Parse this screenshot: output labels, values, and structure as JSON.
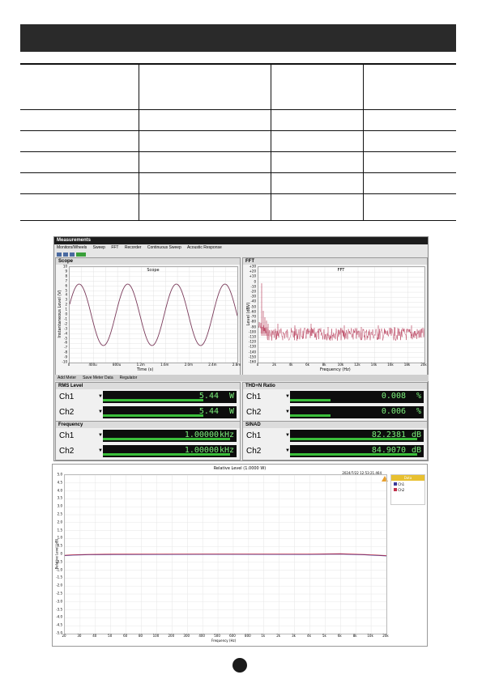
{
  "measurements": {
    "window_title": "Measurements",
    "menu": [
      "Monitors/Wheels",
      "Sweep",
      "FFT",
      "Recorder",
      "Continuous Sweep",
      "Acoustic Response"
    ],
    "scope": {
      "label": "Scope",
      "plot_title": "Scope",
      "xlabel": "Time (s)",
      "ylabel": "Instantaneous Level (V)",
      "yticks": [
        "10",
        "9",
        "8",
        "7",
        "6",
        "5",
        "4",
        "3",
        "2",
        "1",
        "0",
        "-1",
        "-2",
        "-3",
        "-4",
        "-5",
        "-6",
        "-7",
        "-8",
        "-9",
        "-10"
      ],
      "xticks": [
        "0",
        "400u",
        "800u",
        "1.2m",
        "1.6m",
        "2.0m",
        "2.4m",
        "2.8m"
      ]
    },
    "fft": {
      "label": "FFT",
      "plot_title": "FFT",
      "xlabel": "Frequency (Hz)",
      "ylabel": "Level (dBV)",
      "yticks": [
        "+30",
        "+20",
        "+10",
        "0",
        "-10",
        "-20",
        "-30",
        "-40",
        "-50",
        "-60",
        "-70",
        "-80",
        "-90",
        "-100",
        "-110",
        "-120",
        "-130",
        "-140",
        "-150",
        "-160"
      ],
      "xticks": [
        "0",
        "2k",
        "4k",
        "6k",
        "8k",
        "10k",
        "12k",
        "14k",
        "16k",
        "18k",
        "20k"
      ]
    },
    "bottom_toolbar": [
      "Add Meter",
      "Save Meter Data",
      "Regulator"
    ],
    "meters": [
      {
        "name": "RMS Level",
        "rows": [
          {
            "ch": "Ch1",
            "value": "5.44",
            "unit": "W",
            "fill": 0.75
          },
          {
            "ch": "Ch2",
            "value": "5.44",
            "unit": "W",
            "fill": 0.75
          }
        ]
      },
      {
        "name": "THD+N Ratio",
        "rows": [
          {
            "ch": "Ch1",
            "value": "0.008",
            "unit": "%",
            "fill": 0.3
          },
          {
            "ch": "Ch2",
            "value": "0.006",
            "unit": "%",
            "fill": 0.3
          }
        ]
      },
      {
        "name": "Frequency",
        "rows": [
          {
            "ch": "Ch1",
            "value": "1.00000",
            "unit": "kHz",
            "fill": 0.95
          },
          {
            "ch": "Ch2",
            "value": "1.00000",
            "unit": "kHz",
            "fill": 0.95
          }
        ]
      },
      {
        "name": "SINAD",
        "rows": [
          {
            "ch": "Ch1",
            "value": "82.2381",
            "unit": "dB",
            "fill": 0.95
          },
          {
            "ch": "Ch2",
            "value": "84.9070",
            "unit": "dB",
            "fill": 0.95
          }
        ]
      }
    ]
  },
  "sweep": {
    "title": "Relative Level (1.0000 W)",
    "timestamp": "2024/7/22 12:53:21.464",
    "legend_title": "Data",
    "legend": [
      {
        "name": "Ch1",
        "color": "#3a3a9a"
      },
      {
        "name": "Ch2",
        "color": "#c0304a"
      }
    ],
    "ylabel": "Relative Level (dB)",
    "xlabel": "Frequency (Hz)",
    "yticks": [
      "5.0",
      "4.5",
      "4.0",
      "3.5",
      "3.0",
      "2.5",
      "2.0",
      "1.5",
      "1.0",
      "0.5",
      "0",
      "-0.5",
      "-1.0",
      "-1.5",
      "-2.0",
      "-2.5",
      "-3.0",
      "-3.5",
      "-4.0",
      "-4.5",
      "-5.0"
    ],
    "xticks": [
      "20",
      "30",
      "40",
      "50",
      "60",
      "80",
      "100",
      "200",
      "300",
      "400",
      "500",
      "600",
      "800",
      "1k",
      "2k",
      "3k",
      "4k",
      "5k",
      "6k",
      "8k",
      "10k",
      "20k"
    ]
  },
  "colors": {
    "header": "#2a2a2a",
    "ch1": "#3a3a9a",
    "ch2": "#c0304a",
    "meter_green": "#7cf07c"
  }
}
